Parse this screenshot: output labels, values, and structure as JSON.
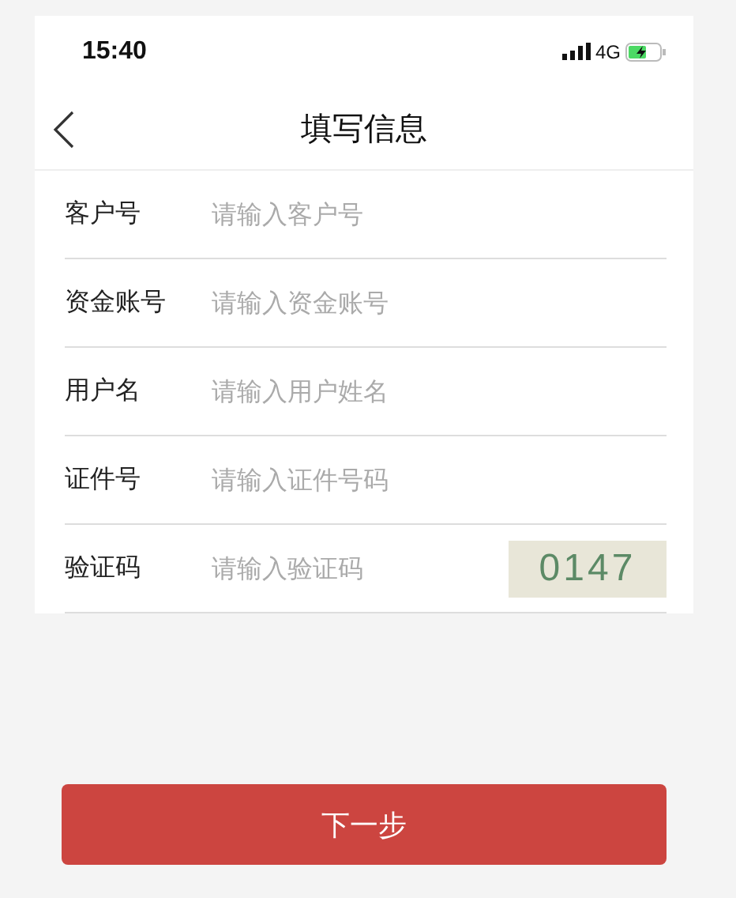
{
  "status_bar": {
    "time": "15:40",
    "network": "4G"
  },
  "nav": {
    "title": "填写信息"
  },
  "fields": [
    {
      "label": "客户号",
      "placeholder": "请输入客户号",
      "kind": "text"
    },
    {
      "label": "资金账号",
      "placeholder": "请输入资金账号",
      "kind": "text"
    },
    {
      "label": "用户名",
      "placeholder": "请输入用户姓名",
      "kind": "text"
    },
    {
      "label": "证件号",
      "placeholder": "请输入证件号码",
      "kind": "text"
    },
    {
      "label": "验证码",
      "placeholder": "请输入验证码",
      "kind": "captcha",
      "captcha": "0147"
    }
  ],
  "button": "下一步"
}
